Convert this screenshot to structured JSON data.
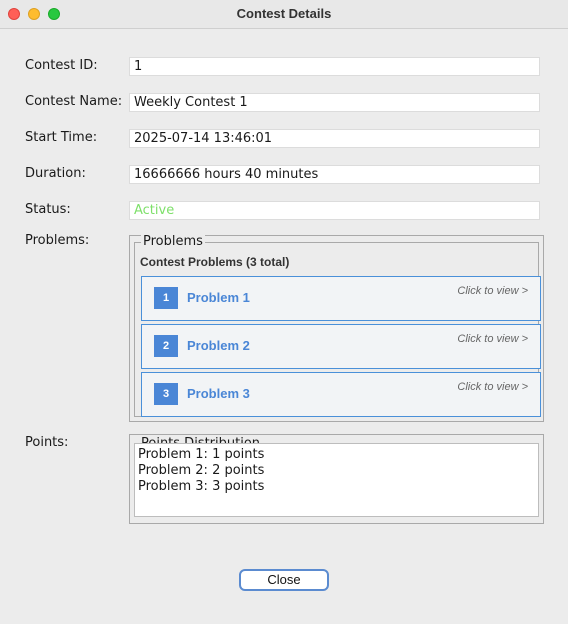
{
  "window": {
    "title": "Contest Details"
  },
  "fields": {
    "contest_id": {
      "label": "Contest ID:",
      "value": "1"
    },
    "contest_name": {
      "label": "Contest Name:",
      "value": "Weekly Contest 1"
    },
    "start_time": {
      "label": "Start Time:",
      "value": "2025-07-14 13:46:01"
    },
    "duration": {
      "label": "Duration:",
      "value": "16666666 hours 40 minutes"
    },
    "status": {
      "label": "Status:",
      "value": "Active",
      "color": "#7ee06a"
    }
  },
  "problems": {
    "label": "Problems:",
    "group_title": "Problems",
    "subtitle": "Contest Problems (3 total)",
    "items": [
      {
        "number": "1",
        "name": "Problem 1",
        "view": "Click to view >"
      },
      {
        "number": "2",
        "name": "Problem 2",
        "view": "Click to view >"
      },
      {
        "number": "3",
        "name": "Problem 3",
        "view": "Click to view >"
      }
    ]
  },
  "points": {
    "label": "Points:",
    "group_title": "Points Distribution",
    "lines": [
      "Problem 1: 1 points",
      "Problem 2: 2 points",
      "Problem 3: 3 points"
    ]
  },
  "buttons": {
    "close": "Close"
  },
  "colors": {
    "accent": "#4a86d6",
    "card_border": "#4a90d9",
    "status_active": "#7ee06a"
  }
}
